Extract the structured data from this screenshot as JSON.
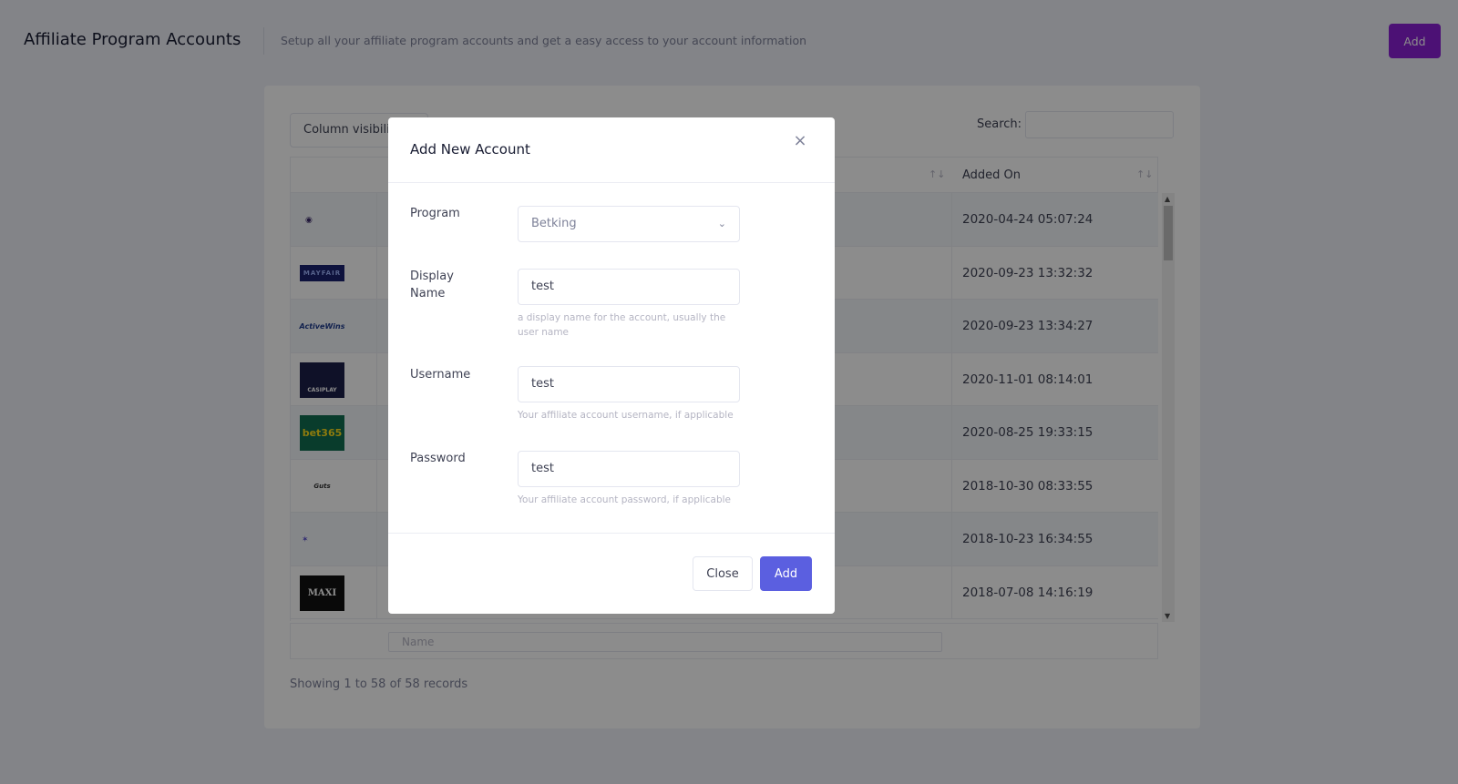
{
  "header": {
    "title": "Affiliate Program Accounts",
    "subtitle": "Setup all your affiliate program accounts and get a easy access to your account information",
    "add_label": "Add"
  },
  "table": {
    "column_visibility_label": "Column visibili",
    "search_label": "Search:",
    "sort_icon": "↑↓",
    "added_on_header": "Added On",
    "rows": [
      {
        "logo_text": "◉",
        "logo_icon": "program-logo-icon",
        "date": "2020-04-24 05:07:24"
      },
      {
        "logo_text": "MAYFAIR",
        "logo_icon": "mayfair-logo",
        "date": "2020-09-23 13:32:32"
      },
      {
        "logo_text": "ActiveWins",
        "logo_icon": "activewins-logo",
        "date": "2020-09-23 13:34:27"
      },
      {
        "logo_text": "CASIPLAY",
        "logo_icon": "casiplay-logo",
        "date": "2020-11-01 08:14:01"
      },
      {
        "logo_text": "bet365",
        "logo_icon": "bet365-logo",
        "date": "2020-08-25 19:33:15"
      },
      {
        "logo_text": "Guts",
        "logo_icon": "guts-logo",
        "date": "2018-10-30 08:33:55"
      },
      {
        "logo_text": "✶",
        "logo_icon": "program-logo-icon",
        "date": "2018-10-23 16:34:55"
      },
      {
        "logo_text": "MAXI",
        "logo_icon": "maxi-affiliates-logo",
        "date": "2018-07-08 14:16:19"
      }
    ],
    "name_filter_placeholder": "Name",
    "records_info": "Showing 1 to 58 of 58 records"
  },
  "modal": {
    "title": "Add New Account",
    "close_icon": "×",
    "program_label": "Program",
    "program_value": "Betking",
    "chevron_icon": "⌄",
    "display_name_label_1": "Display",
    "display_name_label_2": "Name",
    "display_name_value": "test",
    "display_name_help": "a display name for the account, usually the user name",
    "username_label": "Username",
    "username_value": "test",
    "username_help": "Your affiliate account username, if applicable",
    "password_label": "Password",
    "password_value": "test",
    "password_help": "Your affiliate account password, if applicable",
    "close_button": "Close",
    "add_button": "Add"
  },
  "colors": {
    "primary_purple": "#8a1fd6",
    "modal_add_blue": "#5b5fe0"
  }
}
